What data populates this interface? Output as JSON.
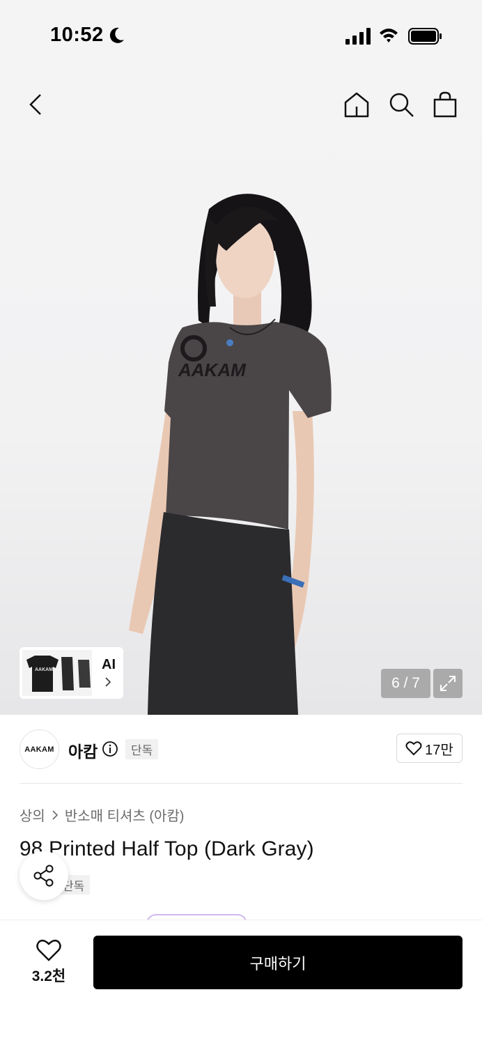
{
  "status_bar": {
    "time": "10:52"
  },
  "gallery": {
    "counter": "6 / 7",
    "ai_label": "AI"
  },
  "brand": {
    "logo_text": "AAKAM",
    "name": "아캄",
    "badge": "단독",
    "likes": "17만"
  },
  "product": {
    "breadcrumb": [
      "상의",
      "반소매 티셔츠 (아캄)"
    ],
    "title": "98 Printed Half Top (Dark Gray)",
    "badge": "단독"
  },
  "bottom_bar": {
    "wish_count": "3.2천",
    "buy_label": "구매하기"
  },
  "colors": {
    "buy_button": "#000000",
    "badge_bg": "#f1f1f1",
    "shirt": "#4a4547",
    "pants": "#2b2b2d"
  },
  "icons": [
    "back-icon",
    "home-icon",
    "search-icon",
    "bag-icon",
    "info-icon",
    "heart-icon",
    "share-icon",
    "expand-icon",
    "moon-icon"
  ]
}
